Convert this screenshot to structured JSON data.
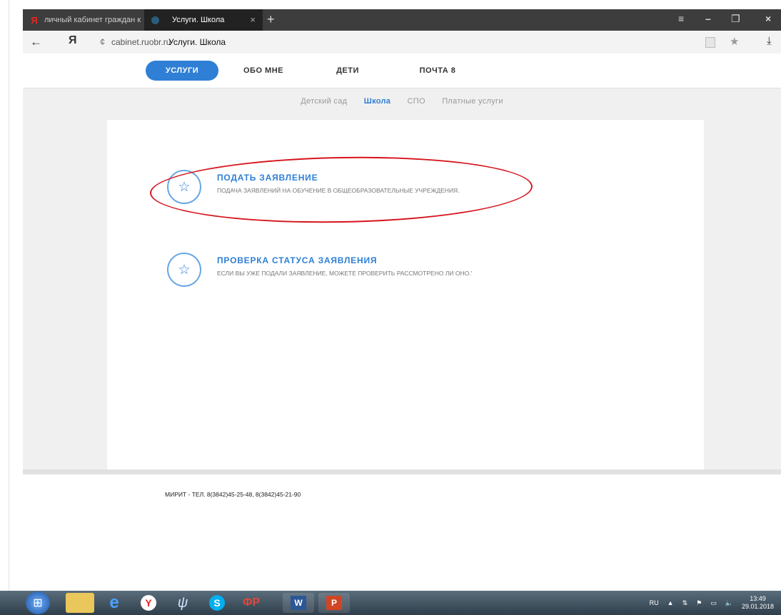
{
  "browser": {
    "tabs": [
      {
        "label": "личный кабинет граждан к",
        "favicon": "Я"
      },
      {
        "label": "Услуги. Школа",
        "close": "×"
      }
    ],
    "new_tab": "+",
    "window_controls": {
      "menu": "≡",
      "minimize": "–",
      "restore": "❐",
      "close": "×"
    },
    "address": {
      "brand": "Я",
      "url": "cabinet.ruobr.ru",
      "page_title": "Услуги. Школа"
    }
  },
  "site": {
    "nav": [
      {
        "label": "УСЛУГИ",
        "active": true
      },
      {
        "label": "ОБО МНЕ"
      },
      {
        "label": "ДЕТИ"
      },
      {
        "label": "ПОЧТА",
        "badge": "8"
      }
    ],
    "subnav": [
      {
        "label": "Детский сад"
      },
      {
        "label": "Школа",
        "active": true
      },
      {
        "label": "СПО"
      },
      {
        "label": "Платные услуги"
      }
    ],
    "services": [
      {
        "title": "ПОДАТЬ ЗАЯВЛЕНИЕ",
        "description": "ПОДАЧА ЗАЯВЛЕНИЙ НА ОБУЧЕНИЕ В ОБЩЕОБРАЗОВАТЕЛЬНЫЕ УЧРЕЖДЕНИЯ.",
        "icon": "star-icon"
      },
      {
        "title": "ПРОВЕРКА СТАТУСА ЗАЯВЛЕНИЯ",
        "description": "ЕСЛИ ВЫ УЖЕ ПОДАЛИ ЗАЯВЛЕНИЕ, МОЖЕТЕ ПРОВЕРИТЬ РАССМОТРЕНО ЛИ ОНО.'",
        "icon": "star-icon"
      }
    ],
    "footer": "МИРИТ - ТЕЛ. 8(3842)45-25-48, 8(3842)45-21-90"
  },
  "taskbar": {
    "language": "RU",
    "time": "13:49",
    "date": "29.01.2018"
  },
  "colors": {
    "accent": "#2e7fd5",
    "annotation": "#d6141c"
  }
}
